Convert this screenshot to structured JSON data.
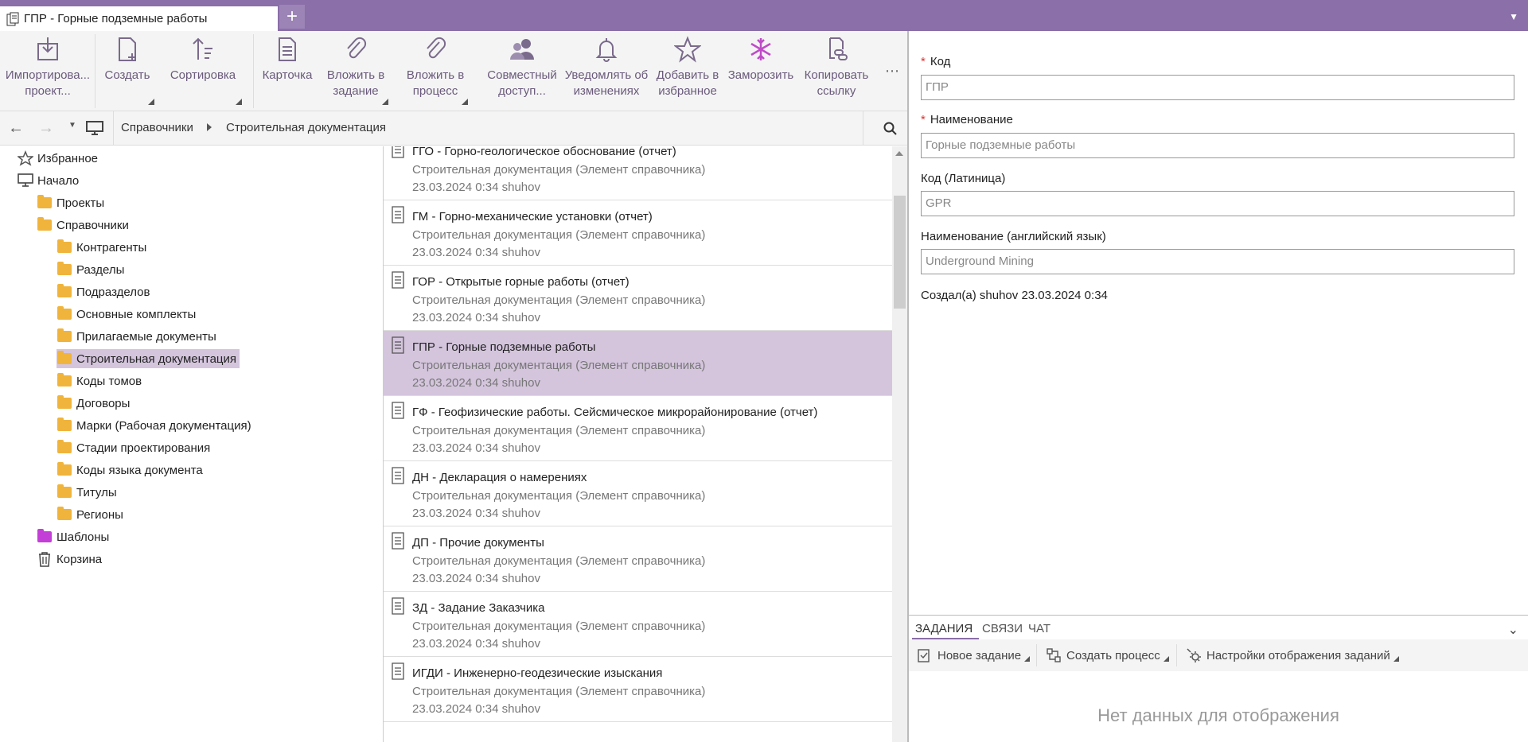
{
  "tab": {
    "title": "ГПР - Горные подземные работы",
    "add": "+"
  },
  "ribbon": [
    {
      "id": "import",
      "label": "Импортирова...\nпроект...",
      "icon": "import-icon"
    },
    {
      "id": "create",
      "label": "Создать",
      "icon": "create-document-icon"
    },
    {
      "id": "sort",
      "label": "Сортировка",
      "icon": "sort-icon"
    },
    {
      "id": "card",
      "label": "Карточка",
      "icon": "card-icon"
    },
    {
      "id": "attach-task",
      "label": "Вложить в\nзадание",
      "icon": "paperclip-icon"
    },
    {
      "id": "attach-process",
      "label": "Вложить в\nпроцесс",
      "icon": "paperclip-icon"
    },
    {
      "id": "share",
      "label": "Совместный\nдоступ...",
      "icon": "users-icon"
    },
    {
      "id": "notify",
      "label": "Уведомлять об\nизменениях",
      "icon": "bell-icon"
    },
    {
      "id": "favorite",
      "label": "Добавить в\nизбранное",
      "icon": "star-icon"
    },
    {
      "id": "freeze",
      "label": "Заморозить",
      "icon": "snowflake-icon"
    },
    {
      "id": "copy-link",
      "label": "Копировать\nссылку",
      "icon": "link-icon"
    }
  ],
  "breadcrumb": [
    "Справочники",
    "Строительная документация"
  ],
  "tree": [
    {
      "label": "Избранное",
      "icon": "star-icon"
    },
    {
      "label": "Начало",
      "icon": "monitor-icon"
    },
    {
      "label": "Проекты",
      "icon": "folder-icon"
    },
    {
      "label": "Справочники",
      "icon": "folder-icon"
    },
    {
      "label": "Контрагенты",
      "icon": "folder-icon"
    },
    {
      "label": "Разделы",
      "icon": "folder-icon"
    },
    {
      "label": "Подразделов",
      "icon": "folder-icon"
    },
    {
      "label": "Основные комплекты",
      "icon": "folder-icon"
    },
    {
      "label": "Прилагаемые документы",
      "icon": "folder-icon"
    },
    {
      "label": "Строительная документация",
      "icon": "folder-icon",
      "selected": true
    },
    {
      "label": "Коды томов",
      "icon": "folder-icon"
    },
    {
      "label": "Договоры",
      "icon": "folder-icon"
    },
    {
      "label": "Марки (Рабочая документация)",
      "icon": "folder-icon"
    },
    {
      "label": "Стадии проектирования",
      "icon": "folder-icon"
    },
    {
      "label": "Коды языка документа",
      "icon": "folder-icon"
    },
    {
      "label": "Титулы",
      "icon": "folder-icon"
    },
    {
      "label": "Регионы",
      "icon": "folder-icon"
    },
    {
      "label": "Шаблоны",
      "icon": "folder-icon",
      "color": "pink"
    },
    {
      "label": "Корзина",
      "icon": "trash-icon"
    }
  ],
  "items": [
    {
      "title": "ГГО - Горно-геологическое обоснование (отчет)",
      "sub": "Строительная документация (Элемент справочника)",
      "meta": "23.03.2024 0:34 shuhov"
    },
    {
      "title": "ГМ - Горно-механические установки (отчет)",
      "sub": "Строительная документация (Элемент справочника)",
      "meta": "23.03.2024 0:34 shuhov"
    },
    {
      "title": "ГОР - Открытые горные работы (отчет)",
      "sub": "Строительная документация (Элемент справочника)",
      "meta": "23.03.2024 0:34 shuhov"
    },
    {
      "title": "ГПР - Горные подземные работы",
      "sub": "Строительная документация (Элемент справочника)",
      "meta": "23.03.2024 0:34 shuhov",
      "selected": true
    },
    {
      "title": "ГФ - Геофизические работы. Сейсмическое микрорайонирование (отчет)",
      "sub": "Строительная документация (Элемент справочника)",
      "meta": "23.03.2024 0:34 shuhov"
    },
    {
      "title": "ДН - Декларация о намерениях",
      "sub": "Строительная документация (Элемент справочника)",
      "meta": "23.03.2024 0:34 shuhov"
    },
    {
      "title": "ДП - Прочие документы",
      "sub": "Строительная документация (Элемент справочника)",
      "meta": "23.03.2024 0:34 shuhov"
    },
    {
      "title": "ЗД - Задание Заказчика",
      "sub": "Строительная документация (Элемент справочника)",
      "meta": "23.03.2024 0:34 shuhov"
    },
    {
      "title": "ИГДИ - Инженерно-геодезические изыскания",
      "sub": "Строительная документация (Элемент справочника)",
      "meta": "23.03.2024 0:34 shuhov"
    }
  ],
  "form": {
    "code_label": "Код",
    "code_value": "ГПР",
    "name_label": "Наименование",
    "name_value": "Горные подземные работы",
    "latin_label": "Код (Латиница)",
    "latin_value": "GPR",
    "en_label": "Наименование (английский язык)",
    "en_value": "Underground Mining",
    "created": "Создал(а) shuhov 23.03.2024 0:34"
  },
  "bottom": {
    "tabs": [
      "ЗАДАНИЯ",
      "СВЯЗИ",
      "ЧАТ"
    ],
    "new_task": "Новое задание",
    "create_process": "Создать процесс",
    "settings": "Настройки отображения заданий",
    "no_data": "Нет данных для отображения"
  },
  "colors": {
    "accent": "#8a6fa8",
    "selection": "#d4c5dd",
    "folder": "#f0b43c"
  }
}
